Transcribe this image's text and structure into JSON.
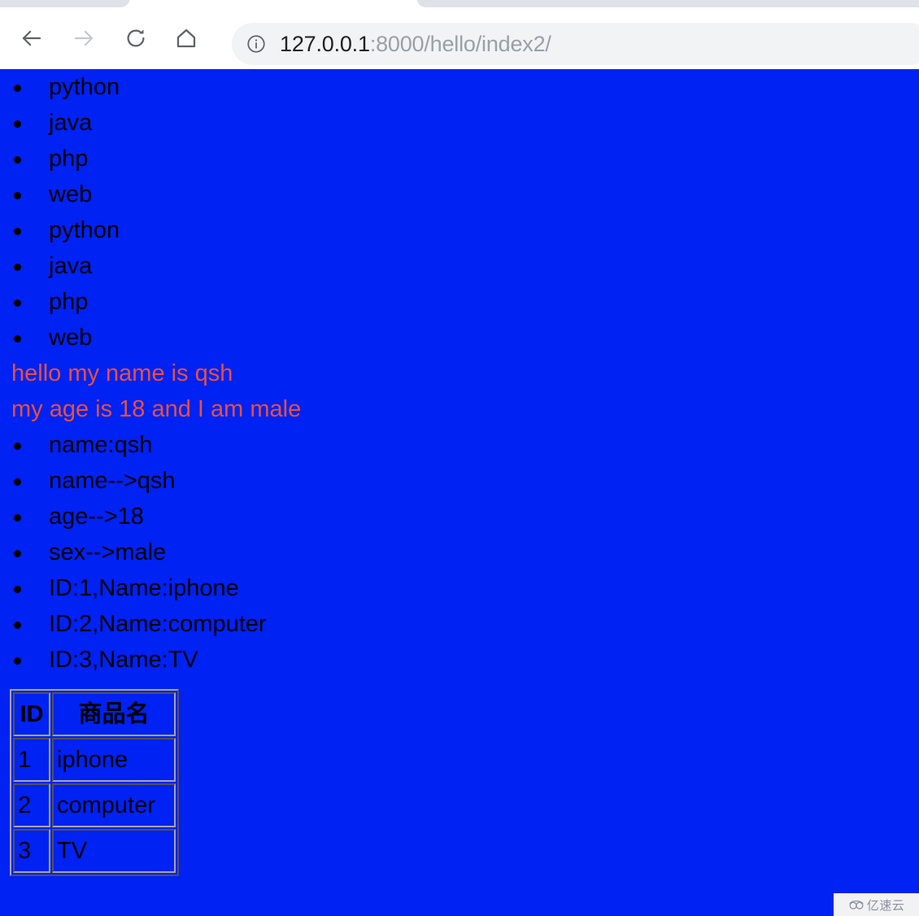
{
  "browser": {
    "back_icon": "arrow-left-icon",
    "forward_icon": "arrow-right-icon",
    "reload_icon": "reload-icon",
    "home_icon": "home-icon",
    "site_info_icon": "info-circle-icon",
    "url_host": "127.0.0.1",
    "url_path": ":8000/hello/index2/",
    "url_full": "127.0.0.1:8000/hello/index2/"
  },
  "page": {
    "background_color": "#0022f2",
    "text_color": "#000000",
    "accent_color": "#e8503e",
    "list_one": [
      "python",
      "java",
      "php",
      "web",
      "python",
      "java",
      "php",
      "web"
    ],
    "paragraphs": [
      "hello my name is qsh",
      "my age is 18 and I am male"
    ],
    "list_two": [
      "name:qsh",
      "name-->qsh",
      "age-->18",
      "sex-->male",
      "ID:1,Name:iphone",
      "ID:2,Name:computer",
      "ID:3,Name:TV"
    ],
    "table": {
      "headers": [
        "ID",
        "商品名"
      ],
      "rows": [
        [
          "1",
          "iphone"
        ],
        [
          "2",
          "computer"
        ],
        [
          "3",
          "TV"
        ]
      ]
    }
  },
  "watermark": {
    "logo_icon": "cloud-logo-icon",
    "text": "亿速云"
  }
}
